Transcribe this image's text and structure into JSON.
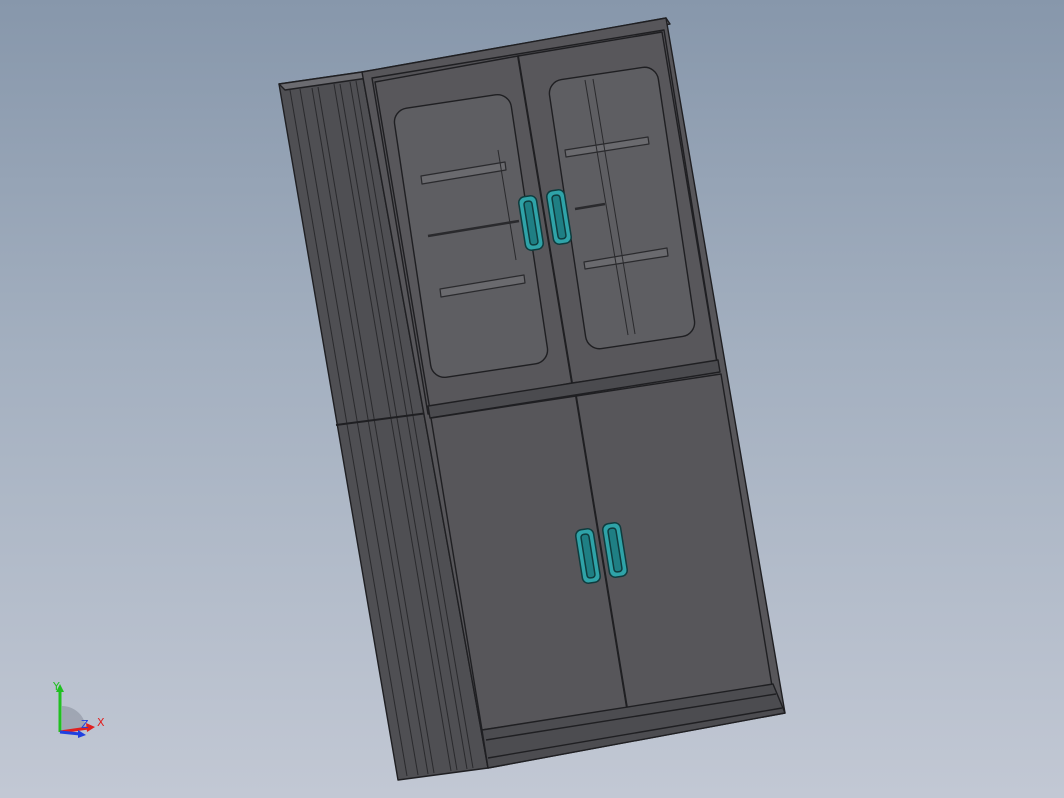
{
  "viewport": {
    "model": "cabinet"
  },
  "colors": {
    "background_top": "#8797ab",
    "background_bottom": "#c2c8d4",
    "body": "#57565a",
    "edge": "#1f1f22",
    "glass": "#5e5e62",
    "handle": "#2fa3a8",
    "axis_x": "#e02020",
    "axis_y": "#20c020",
    "axis_z": "#2040e0"
  },
  "triad": {
    "x_label": "X",
    "y_label": "Y",
    "z_label": "Z"
  },
  "icons": [
    "view-orientation-triad-icon"
  ]
}
